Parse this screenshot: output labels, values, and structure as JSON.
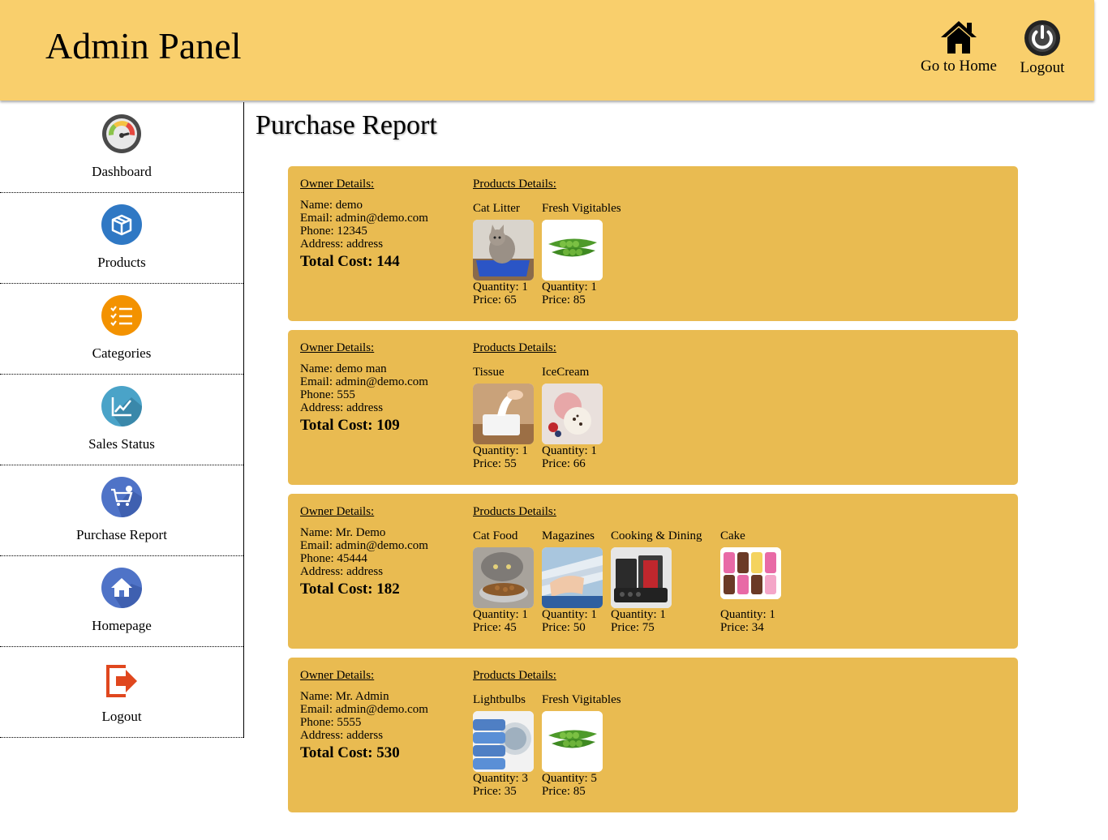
{
  "header": {
    "title": "Admin Panel",
    "home_label": "Go to Home",
    "logout_label": "Logout"
  },
  "sidebar": {
    "items": [
      {
        "label": "Dashboard",
        "icon": "speedometer-icon"
      },
      {
        "label": "Products",
        "icon": "box-icon"
      },
      {
        "label": "Categories",
        "icon": "checklist-icon"
      },
      {
        "label": "Sales Status",
        "icon": "line-chart-icon"
      },
      {
        "label": "Purchase Report",
        "icon": "cart-icon"
      },
      {
        "label": "Homepage",
        "icon": "house-icon"
      },
      {
        "label": "Logout",
        "icon": "exit-icon"
      }
    ]
  },
  "page": {
    "title": "Purchase Report"
  },
  "labels": {
    "owner_details": "Owner Details:",
    "products_details": "Products Details:"
  },
  "orders": [
    {
      "name": "Name: demo",
      "email": "Email: admin@demo.com",
      "phone": "Phone: 12345",
      "address": "Address: address",
      "total": "Total Cost: 144",
      "products": [
        {
          "name": "Cat Litter",
          "qty": "Quantity: 1",
          "price": "Price: 65",
          "img": "cat-litter-image"
        },
        {
          "name": "Fresh Vigitables",
          "qty": "Quantity: 1",
          "price": "Price: 85",
          "img": "peas-image"
        }
      ]
    },
    {
      "name": "Name: demo man",
      "email": "Email: admin@demo.com",
      "phone": "Phone: 555",
      "address": "Address: address",
      "total": "Total Cost: 109",
      "products": [
        {
          "name": "Tissue",
          "qty": "Quantity: 1",
          "price": "Price: 55",
          "img": "tissue-image"
        },
        {
          "name": "IceCream",
          "qty": "Quantity: 1",
          "price": "Price: 66",
          "img": "icecream-image"
        }
      ]
    },
    {
      "name": "Name: Mr. Demo",
      "email": "Email: admin@demo.com",
      "phone": "Phone: 45444",
      "address": "Address: address",
      "total": "Total Cost: 182",
      "products": [
        {
          "name": "Cat Food",
          "qty": "Quantity: 1",
          "price": "Price: 45",
          "img": "cat-food-image"
        },
        {
          "name": "Magazines",
          "qty": "Quantity: 1",
          "price": "Price: 50",
          "img": "magazines-image"
        },
        {
          "name": "Cooking & Dining",
          "qty": "Quantity: 1",
          "price": "Price: 75",
          "img": "cookware-image"
        },
        {
          "name": "Cake",
          "qty": "Quantity: 1",
          "price": "Price: 34",
          "img": "cake-image"
        }
      ]
    },
    {
      "name": "Name: Mr. Admin",
      "email": "Email: admin@demo.com",
      "phone": "Phone: 5555",
      "address": "Address: adderss",
      "total": "Total Cost: 530",
      "products": [
        {
          "name": "Lightbulbs",
          "qty": "Quantity: 3",
          "price": "Price: 35",
          "img": "towels-image"
        },
        {
          "name": "Fresh Vigitables",
          "qty": "Quantity: 5",
          "price": "Price: 85",
          "img": "peas-image"
        }
      ]
    }
  ]
}
